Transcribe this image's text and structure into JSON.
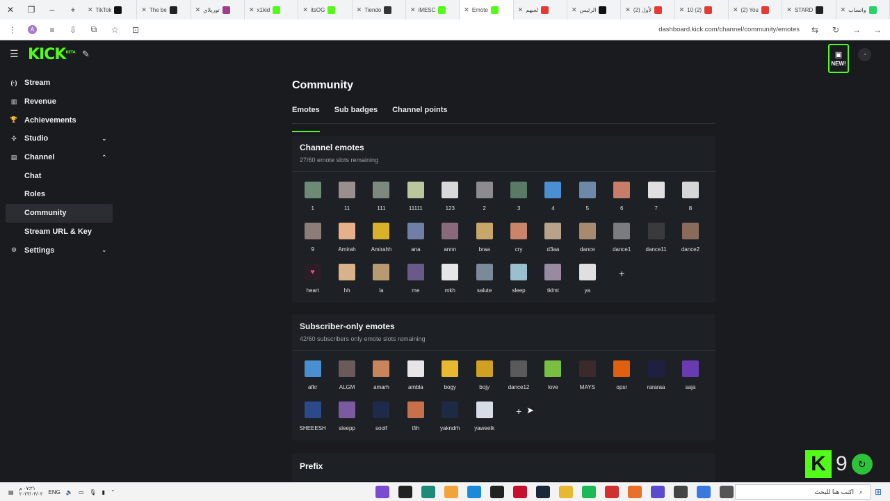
{
  "browser": {
    "tabs": [
      {
        "label": "TikTok",
        "color": "#111111"
      },
      {
        "label": "The be",
        "color": "#222222"
      },
      {
        "label": "توريلاي",
        "color": "#a43c8c"
      },
      {
        "label": "x1kid",
        "color": "#53fc18"
      },
      {
        "label": "itsOG",
        "color": "#53fc18"
      },
      {
        "label": "Tiendo",
        "color": "#333333"
      },
      {
        "label": "iMESC",
        "color": "#53fc18"
      },
      {
        "label": "Emote",
        "color": "#53fc18",
        "active": true
      },
      {
        "label": "لعبهم",
        "color": "#e53935"
      },
      {
        "label": "الرئيس",
        "color": "#111111"
      },
      {
        "label": "(2) لأول",
        "color": "#e53935"
      },
      {
        "label": "10 (2)",
        "color": "#e53935"
      },
      {
        "label": "(2) You",
        "color": "#e53935"
      },
      {
        "label": "STARD",
        "color": "#222222"
      },
      {
        "label": "واتساب",
        "color": "#25d366"
      }
    ],
    "url": "dashboard.kick.com/channel/community/emotes",
    "avatar_letter": "A"
  },
  "app": {
    "logo": "KICK",
    "logo_sup": "BETA",
    "new_badge": "NEW!"
  },
  "sidebar": {
    "items": [
      {
        "label": "Stream",
        "icon": "(·)"
      },
      {
        "label": "Revenue",
        "icon": "▥"
      },
      {
        "label": "Achievements",
        "icon": "🏆"
      },
      {
        "label": "Studio",
        "icon": "✣",
        "chevron": "⌄"
      },
      {
        "label": "Channel",
        "icon": "▤",
        "chevron": "⌃"
      }
    ],
    "sub_items": [
      "Chat",
      "Roles",
      "Community",
      "Stream URL & Key"
    ],
    "settings": {
      "label": "Settings",
      "icon": "⚙",
      "chevron": "⌄"
    }
  },
  "main": {
    "title": "Community",
    "tabs": [
      "Emotes",
      "Sub badges",
      "Channel points"
    ],
    "channel_emotes": {
      "title": "Channel emotes",
      "subtitle": "27/60 emote slots remaining",
      "emotes": [
        {
          "name": "1",
          "color": "#6d8a76"
        },
        {
          "name": "11",
          "color": "#9a8e8f"
        },
        {
          "name": "111",
          "color": "#7c8a7e"
        },
        {
          "name": "11111",
          "color": "#b9c79d"
        },
        {
          "name": "123",
          "color": "#d9d9d9"
        },
        {
          "name": "2",
          "color": "#8c8c90"
        },
        {
          "name": "3",
          "color": "#5a7a66"
        },
        {
          "name": "4",
          "color": "#4a8fd1"
        },
        {
          "name": "5",
          "color": "#6d88a8"
        },
        {
          "name": "6",
          "color": "#c87c6a"
        },
        {
          "name": "7",
          "color": "#e0e0e0"
        },
        {
          "name": "8",
          "color": "#d6d6d6"
        },
        {
          "name": "9",
          "color": "#8d7d78"
        },
        {
          "name": "Amirah",
          "color": "#e8b08a"
        },
        {
          "name": "Amirahh",
          "color": "#d9b22a"
        },
        {
          "name": "ana",
          "color": "#6f7fa8"
        },
        {
          "name": "annn",
          "color": "#8a6a7a"
        },
        {
          "name": "braa",
          "color": "#c8a66a"
        },
        {
          "name": "cry",
          "color": "#c9846a"
        },
        {
          "name": "d3aa",
          "color": "#b8a38a"
        },
        {
          "name": "dance",
          "color": "#a88a70"
        },
        {
          "name": "dance1",
          "color": "#7a7c80"
        },
        {
          "name": "dance11",
          "color": "#3a3a3c"
        },
        {
          "name": "dance2",
          "color": "#8a6a5a"
        },
        {
          "name": "heart",
          "color": "#2b1e24"
        },
        {
          "name": "hh",
          "color": "#d8b28a"
        },
        {
          "name": "la",
          "color": "#b89a70"
        },
        {
          "name": "me",
          "color": "#6a5a8a"
        },
        {
          "name": "mkh",
          "color": "#e6e6e6"
        },
        {
          "name": "salute",
          "color": "#7a8a9a"
        },
        {
          "name": "sleep",
          "color": "#9ac0d0"
        },
        {
          "name": "tklmt",
          "color": "#9a8aa0"
        },
        {
          "name": "ya",
          "color": "#e0e0e0"
        }
      ]
    },
    "subscriber_emotes": {
      "title": "Subscriber-only emotes",
      "subtitle": "42/60 subscribers only emote slots remaining",
      "emotes": [
        {
          "name": "afkr",
          "color": "#4a8fd1"
        },
        {
          "name": "ALGM",
          "color": "#6a5a5a"
        },
        {
          "name": "amarh",
          "color": "#c8845a"
        },
        {
          "name": "ambla",
          "color": "#e6e6e6"
        },
        {
          "name": "bogy",
          "color": "#e8b830"
        },
        {
          "name": "bojy",
          "color": "#d0a020"
        },
        {
          "name": "dance12",
          "color": "#5a5a5a"
        },
        {
          "name": "love",
          "color": "#7ac040"
        },
        {
          "name": "MAYS",
          "color": "#3a2a2a"
        },
        {
          "name": "opsr",
          "color": "#e06010"
        },
        {
          "name": "rararaa",
          "color": "#1e2040"
        },
        {
          "name": "saja",
          "color": "#6a3ab0"
        },
        {
          "name": "SHEEESH",
          "color": "#2a4a8a"
        },
        {
          "name": "sleepp",
          "color": "#7a5aa0"
        },
        {
          "name": "soolf",
          "color": "#1e2a4a"
        },
        {
          "name": "tfih",
          "color": "#c8704a"
        },
        {
          "name": "yakndrh",
          "color": "#1e2a44"
        },
        {
          "name": "yaweelk",
          "color": "#d6dde6"
        }
      ]
    },
    "add_symbol": "+",
    "prefix_title": "Prefix"
  },
  "widget": {
    "letter": "K",
    "number": "9"
  },
  "taskbar": {
    "clock_time": "٠٧:٢١ م",
    "clock_date": "٢٠٢٣/٠٣/٠٢",
    "lang": "ENG",
    "search_placeholder": "اكتب هنا للبحث",
    "apps": [
      "#7a4ad0",
      "#222222",
      "#1f8a7a",
      "#f2a33a",
      "#1a8ad8",
      "#222222",
      "#c8102e",
      "#1b2838",
      "#e8b830",
      "#1db954",
      "#d03030",
      "#e8702a",
      "#5a4ad0",
      "#444444",
      "#3a7ae0",
      "#555555"
    ]
  }
}
